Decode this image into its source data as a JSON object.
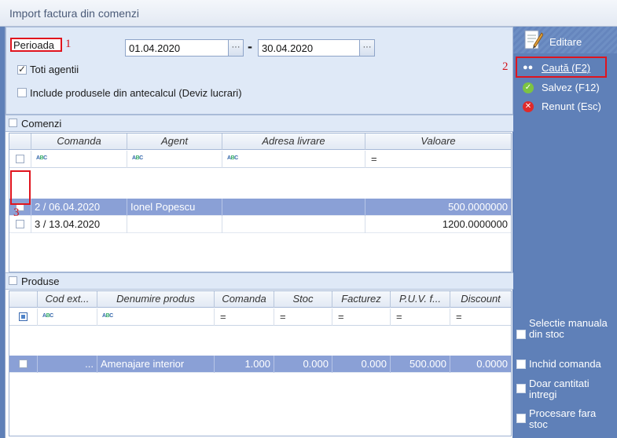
{
  "window": {
    "title": "Import factura din comenzi"
  },
  "period": {
    "label": "Perioada",
    "annotation": "1",
    "date_from": "01.04.2020",
    "date_to": "30.04.2020",
    "separator": "-",
    "ellipsis": "···",
    "toti_agentii_label": "Toti agentii",
    "toti_agentii_checked": true,
    "include_label": "Include produsele din antecalcul (Deviz lucrari)",
    "include_checked": false
  },
  "comenzi": {
    "section_label": "Comenzi",
    "annotation": "3",
    "columns": [
      "Comanda",
      "Agent",
      "Adresa livrare",
      "Valoare"
    ],
    "filter_abc": "ABC",
    "filter_eq": "=",
    "rows": [
      {
        "comanda": "2 / 06.04.2020",
        "agent": "Ionel Popescu",
        "adresa": "",
        "valoare": "500.0000000",
        "selected": true
      },
      {
        "comanda": "3 / 13.04.2020",
        "agent": "",
        "adresa": "",
        "valoare": "1200.0000000",
        "selected": false
      }
    ]
  },
  "produse": {
    "section_label": "Produse",
    "columns": [
      "Cod ext...",
      "Denumire produs",
      "Comanda",
      "Stoc",
      "Facturez",
      "P.U.V. f...",
      "Discount"
    ],
    "rows": [
      {
        "cod": "...",
        "denumire": "Amenajare interior",
        "comanda": "1.000",
        "stoc": "0.000",
        "facturez": "0.000",
        "puv": "500.000",
        "discount": "0.0000"
      }
    ]
  },
  "side": {
    "editare": "Editare",
    "annotation": "2",
    "cauta": "Caută (F2)",
    "salvez": "Salvez (F12)",
    "renunt": "Renunt (Esc)",
    "options": [
      {
        "label": "Selectie manuala din stoc"
      },
      {
        "label": "Inchid comanda"
      },
      {
        "label": "Doar cantitati intregi"
      },
      {
        "label": "Procesare fara stoc"
      }
    ]
  }
}
